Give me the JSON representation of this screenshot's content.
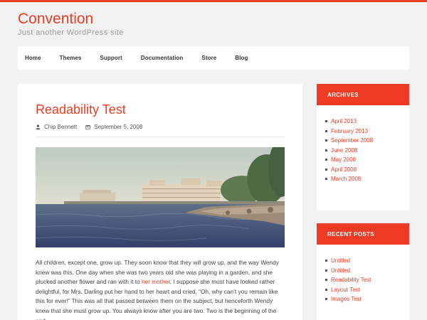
{
  "site": {
    "title": "Convention",
    "description": "Just another WordPress site"
  },
  "nav": {
    "items": [
      "Home",
      "Themes",
      "Support",
      "Documentation",
      "Store",
      "Blog"
    ]
  },
  "post": {
    "title": "Readability Test",
    "author": "Chip Bennett",
    "date": "September 5, 2008",
    "content_part1": "All children, except one, grow up. They soon know that they will grow up, and the way Wendy knew was this. One day when she was two years old she was playing in a garden, and she plucked another flower and ran with it to ",
    "content_link": "her mother",
    "content_part2": ". I suppose she must have looked rather delightful, for Mrs. Darling put her hand to her heart and cried, “Oh, why can’t you remain like this for ever!” This was all that passed between them on the subject, but henceforth Wendy knew that she must grow up. You always know after you are two. Two is the beginning of the end."
  },
  "sidebar": {
    "archives": {
      "title": "ARCHIVES",
      "items": [
        "April 2013",
        "February 2013",
        "September 2008",
        "June 2008",
        "May 2008",
        "April 2008",
        "March 2008"
      ]
    },
    "recent": {
      "title": "RECENT POSTS",
      "items": [
        "Untitled",
        "Untitled",
        "Readability Test",
        "Layout Test",
        "Images Test"
      ]
    }
  },
  "colors": {
    "accent": "#ef3b24",
    "background": "#f2f2f2"
  },
  "icons": {
    "author": "user-icon",
    "date": "calendar-icon"
  }
}
